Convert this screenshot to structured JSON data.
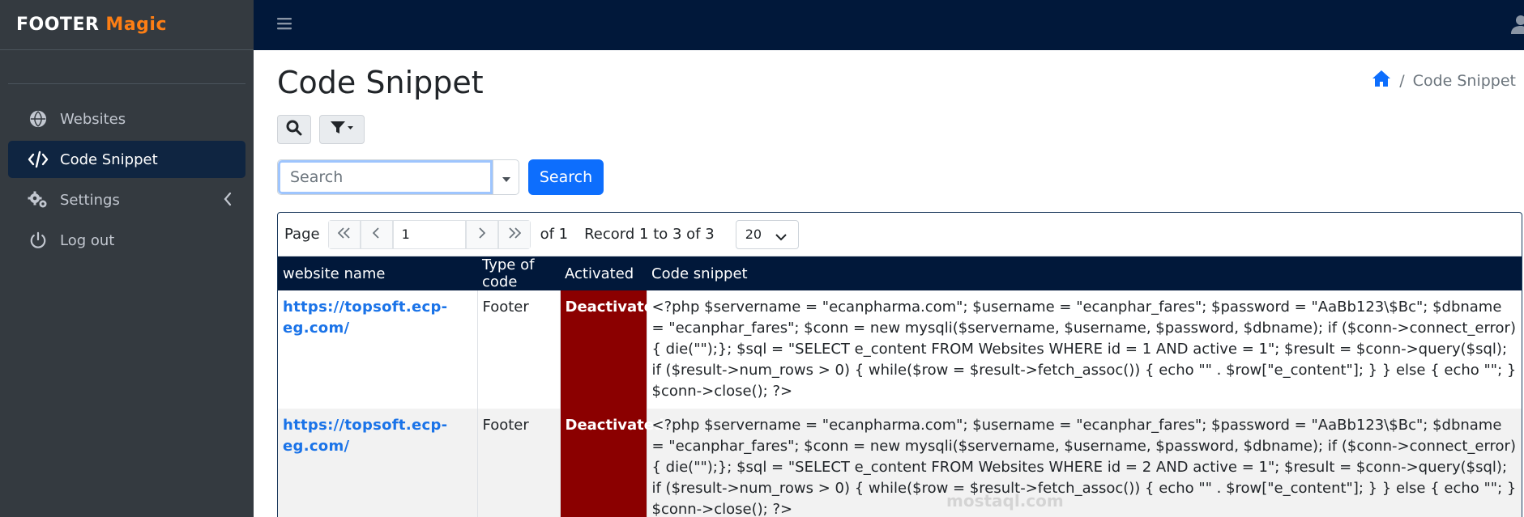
{
  "brand": {
    "part1": "FOOTER",
    "part2": "Magic"
  },
  "colors": {
    "sidebar": "#343a40",
    "topbar": "#01183a",
    "accent": "#fd7e14",
    "primary": "#0d6efd",
    "deactivated": "#8b0000",
    "link": "#1a73e8"
  },
  "sidebar": {
    "items": [
      {
        "label": "Websites",
        "icon": "globe-icon"
      },
      {
        "label": "Code Snippet",
        "icon": "code-icon",
        "active": true
      },
      {
        "label": "Settings",
        "icon": "gears-icon"
      },
      {
        "label": "Log out",
        "icon": "power-icon"
      }
    ]
  },
  "page": {
    "title": "Code Snippet"
  },
  "breadcrumb": {
    "separator": "/",
    "current": "Code Snippet"
  },
  "search": {
    "placeholder": "Search",
    "button": "Search"
  },
  "pager": {
    "page_label": "Page",
    "current_page": "1",
    "of_label": "of 1",
    "records": "Record 1 to 3 of 3",
    "page_size": "20"
  },
  "table": {
    "headers": [
      "website name",
      "Type of code",
      "Activated",
      "Code snippet"
    ],
    "rows": [
      {
        "website": "https://topsoft.ecp-eg.com/",
        "type": "Footer",
        "activated": "Deactivated",
        "code": "<?php $servername = \"ecanpharma.com\"; $username = \"ecanphar_fares\"; $password = \"AaBb123\\$Bc\"; $dbname = \"ecanphar_fares\"; $conn = new mysqli($servername, $username, $password, $dbname); if ($conn->connect_error) { die(\"\");}; $sql = \"SELECT e_content FROM Websites WHERE id = 1 AND active = 1\"; $result = $conn->query($sql); if ($result->num_rows > 0) { while($row = $result->fetch_assoc()) { echo \"\" . $row[\"e_content\"]; } } else { echo \"\"; } $conn->close(); ?>"
      },
      {
        "website": "https://topsoft.ecp-eg.com/",
        "type": "Footer",
        "activated": "Deactivated",
        "code": "<?php $servername = \"ecanpharma.com\"; $username = \"ecanphar_fares\"; $password = \"AaBb123\\$Bc\"; $dbname = \"ecanphar_fares\"; $conn = new mysqli($servername, $username, $password, $dbname); if ($conn->connect_error) { die(\"\");}; $sql = \"SELECT e_content FROM Websites WHERE id = 2 AND active = 1\"; $result = $conn->query($sql); if ($result->num_rows > 0) { while($row = $result->fetch_assoc()) { echo \"\" . $row[\"e_content\"]; } } else { echo \"\"; } $conn->close(); ?>"
      }
    ]
  },
  "watermark": "mostaql.com"
}
